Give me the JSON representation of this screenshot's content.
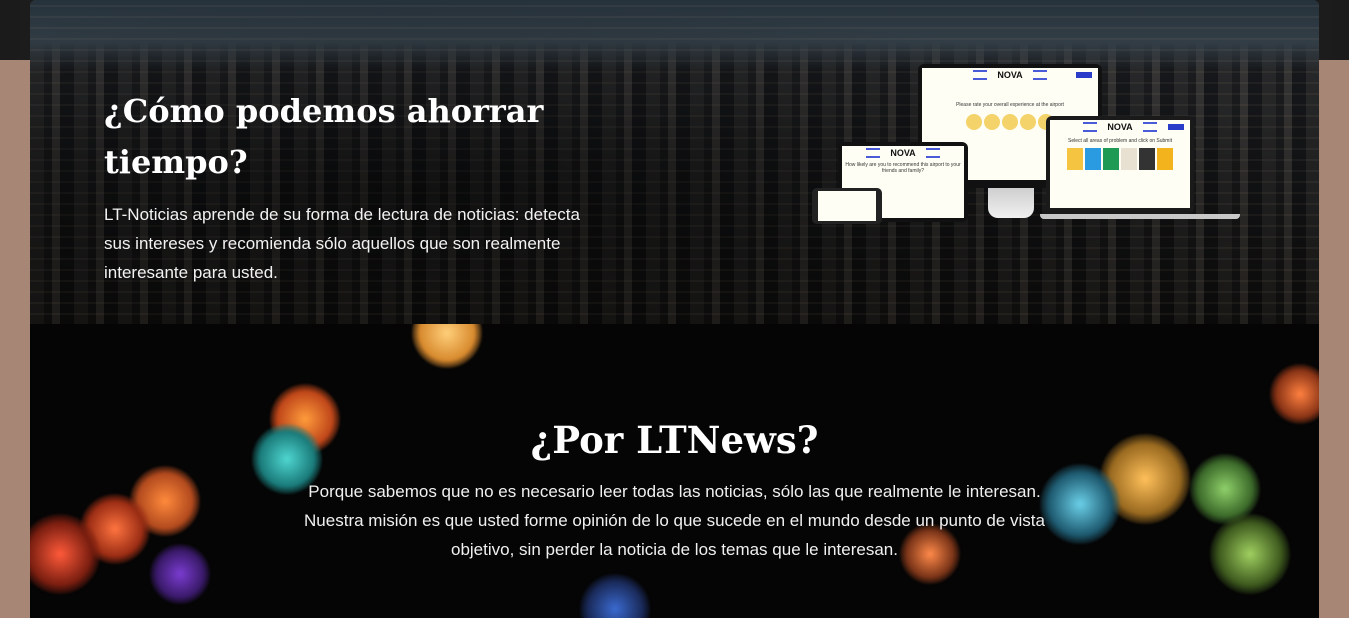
{
  "hero": {
    "title": "¿Cómo podemos ahorrar tiempo?",
    "description": "LT-Noticias aprende de su forma de lectura de noticias: detecta sus intereses y recomienda sólo aquellos que son realmente interesante para usted."
  },
  "devices": {
    "brand": "NOVA",
    "monitor_question": "Please rate your overall experience at the airport",
    "laptop_question": "Select all areas of problem and click on Submit",
    "tablet_question": "How likely are you to recommend this airport to your friends and family?"
  },
  "why": {
    "title": "¿Por LTNews?",
    "description": "Porque sabemos que no es necesario leer todas las noticias, sólo las que realmente le interesan. Nuestra misión es que usted forme opinión de lo que sucede en el mundo desde un punto de vista objetivo, sin perder la noticia de los temas que le interesan."
  },
  "colors": {
    "page_background": "#a88676",
    "accent_blue": "#2a3cc8"
  }
}
